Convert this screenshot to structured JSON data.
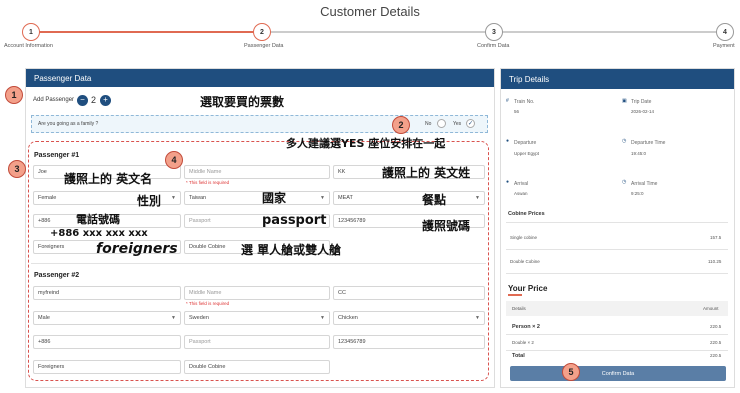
{
  "page_title": "Customer Details",
  "stepper": {
    "steps": [
      {
        "num": "1",
        "label": "Account Information"
      },
      {
        "num": "2",
        "label": "Passenger Data"
      },
      {
        "num": "3",
        "label": "Confirm Data"
      },
      {
        "num": "4",
        "label": "Payment"
      }
    ]
  },
  "passenger_panel": {
    "title": "Passenger Data",
    "add_label": "Add Passenger",
    "count": "2",
    "family_question": "Are you going as a family ?",
    "no_label": "No",
    "yes_label": "Yes",
    "passengers": [
      {
        "title": "Passenger #1",
        "first_name": "Joe",
        "middle_name_ph": "Middle Name",
        "required": "* This field is required",
        "last_name": "KK",
        "gender": "Female",
        "country": "Taiwan",
        "meal": "MEAT",
        "phone": "+886",
        "passport_ph": "Passport",
        "passport_no": "123456789",
        "nationality": "Foreigners",
        "cabin": "Double Cobine"
      },
      {
        "title": "Passenger #2",
        "first_name": "myfreind",
        "middle_name_ph": "Middle Name",
        "required": "* This field is required",
        "last_name": "CC",
        "gender": "Male",
        "country": "Sweden",
        "meal": "Chicken",
        "phone": "+886",
        "passport_ph": "Passport",
        "passport_no": "123456789",
        "nationality": "Foreigners",
        "cabin": "Double Cobine"
      }
    ]
  },
  "trip_panel": {
    "title": "Trip Details",
    "train_no_label": "Train No.",
    "train_no": "56",
    "trip_date_label": "Trip Date",
    "trip_date": "2026-02-14",
    "departure_label": "Departure",
    "departure": "Upper Egypt",
    "departure_time_label": "Departure Time",
    "departure_time": "19:45:0",
    "arrival_label": "Arrival",
    "arrival": "Aswan",
    "arrival_time_label": "Arrival Time",
    "arrival_time": "9:25:0",
    "cabine_prices_label": "Cobine Prices",
    "cabine_prices": [
      {
        "name": "Single cobine",
        "price": "157.5"
      },
      {
        "name": "Double Cobine",
        "price": "110.25"
      }
    ],
    "your_price_label": "Your Price",
    "details_header": "Details",
    "amount_header": "Amount",
    "price_rows": [
      {
        "name": "Person × 2",
        "amount": "220.5",
        "bold": true
      },
      {
        "name": "Double × 2",
        "amount": "220.5",
        "bold": false
      },
      {
        "name": "Total",
        "amount": "220.5",
        "bold": true
      }
    ],
    "confirm_button": "Confirm Data"
  },
  "annotations": {
    "b1": "1",
    "b2": "2",
    "b3": "3",
    "b4": "4",
    "b5": "5",
    "choose_tickets": "選取要買的票數",
    "family_note": "多人建議選YES 座位安排在一起",
    "passport_first": "護照上的 英文名",
    "passport_last": "護照上的 英文姓",
    "gender": "性別",
    "country": "國家",
    "meal": "餐點",
    "phone": "電話號碼",
    "phone_example": "+886 xxx xxx xxx",
    "passport": "passport",
    "passport_number": "護照號碼",
    "foreigners": "foreigners",
    "cabin_choice": "選 單人艙或雙人艙"
  },
  "colors": {
    "accent": "#e06a52",
    "header_blue": "#1f4e7f",
    "button_blue": "#5a7ea6",
    "badge_fill": "#f3a08a"
  }
}
